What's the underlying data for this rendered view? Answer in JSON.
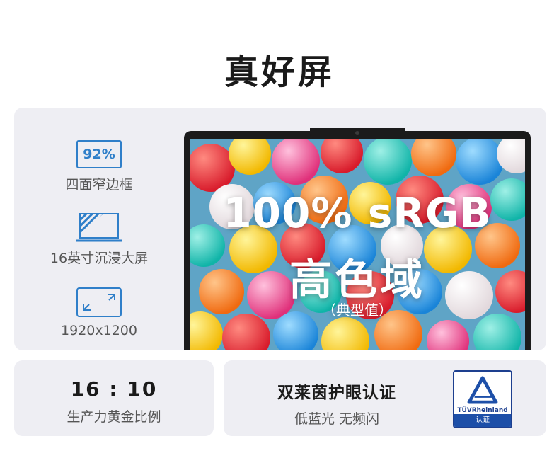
{
  "title": "真好屏",
  "features": [
    {
      "icon_name": "bezel-percent-icon",
      "icon_text": "92%",
      "label": "四面窄边框"
    },
    {
      "icon_name": "laptop-screen-icon",
      "label": "16英寸沉浸大屏"
    },
    {
      "icon_name": "resolution-expand-icon",
      "label": "1920x1200"
    }
  ],
  "screen": {
    "line1": "100% sRGB",
    "line2": "高色域",
    "line3": "（典型值）"
  },
  "aspect_card": {
    "value": "16 : 10",
    "label": "生产力黄金比例"
  },
  "eye_card": {
    "title": "双莱茵护眼认证",
    "subtitle": "低蓝光 无频闪",
    "badge_name": "TÜVRheinland",
    "badge_label": "认证"
  },
  "colors": {
    "accent": "#2f7fc9",
    "panel": "#eeeef3",
    "tuv_blue": "#1d4fa8"
  }
}
